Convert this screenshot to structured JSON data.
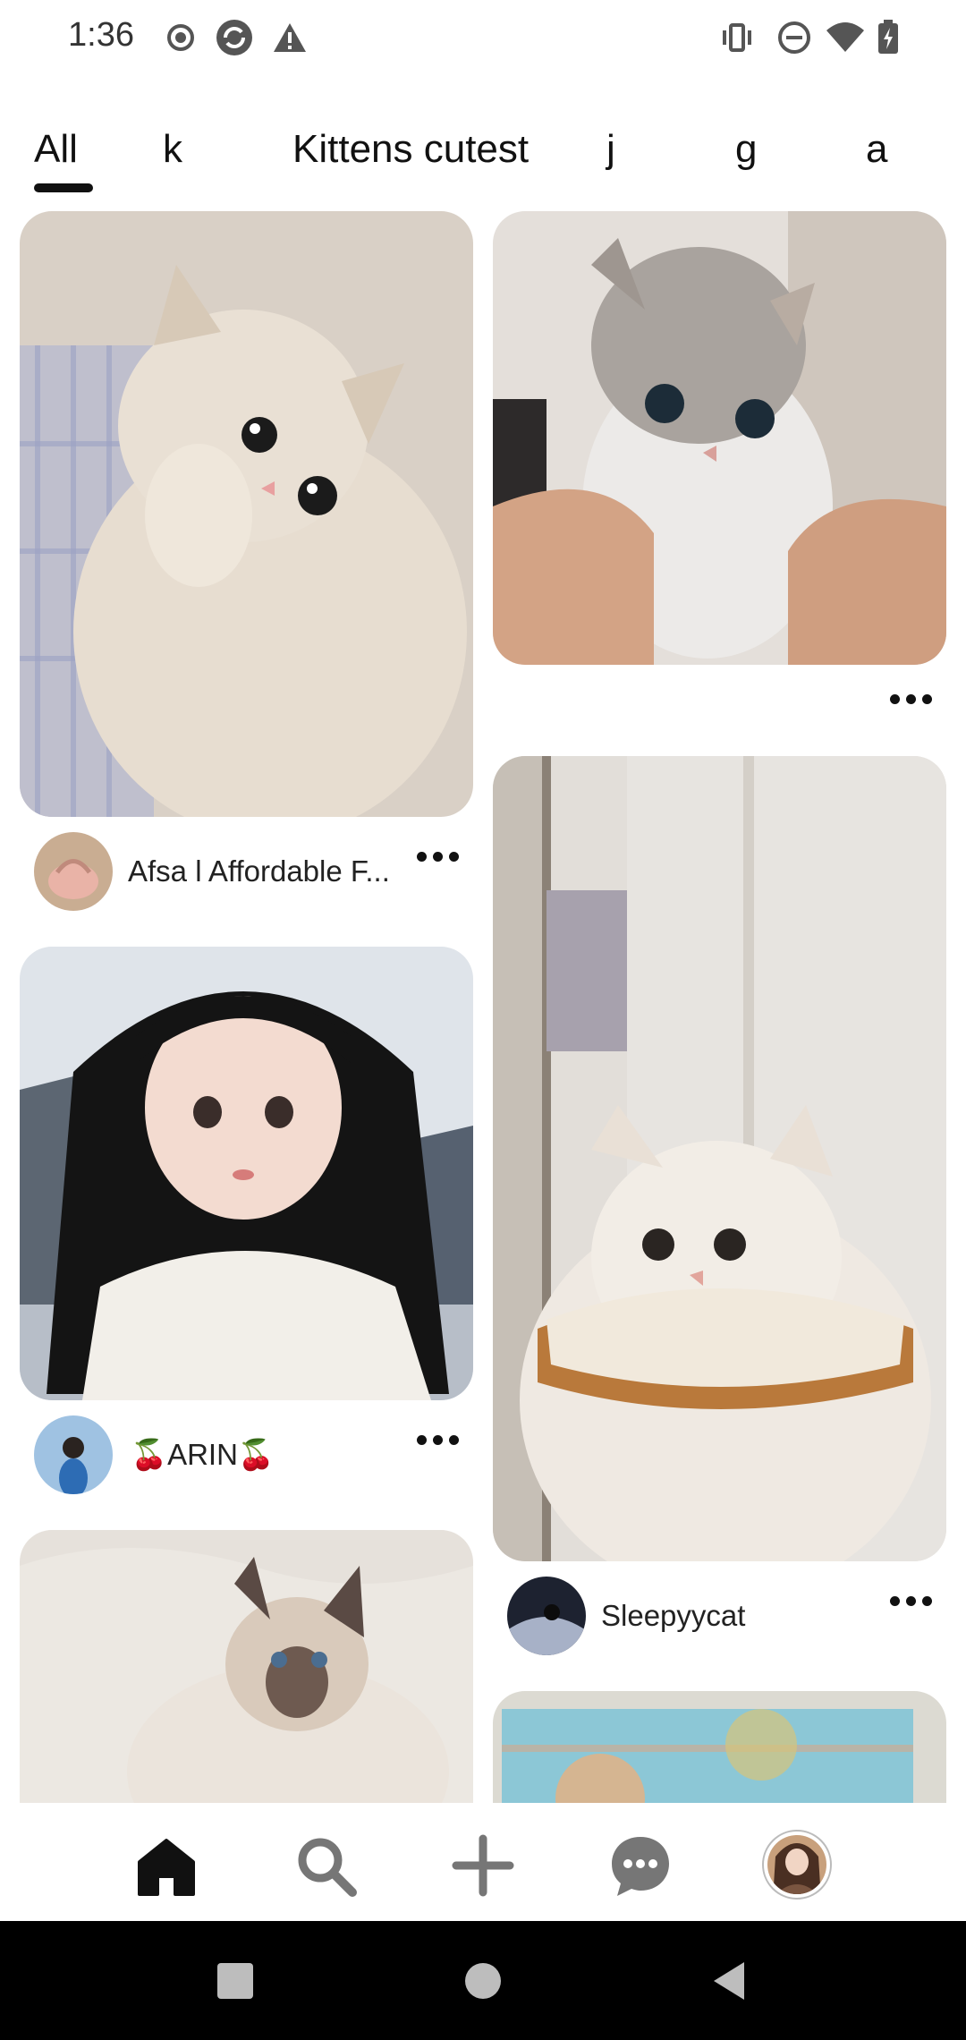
{
  "status_bar": {
    "time": "1:36",
    "left_icons": [
      "record-icon",
      "sync-icon",
      "warning-icon"
    ],
    "right_icons": [
      "vibrate-icon",
      "do-not-disturb-icon",
      "wifi-icon",
      "battery-charging-icon"
    ]
  },
  "tabs": [
    {
      "label": "All",
      "selected": true
    },
    {
      "label": "k",
      "selected": false
    },
    {
      "label": "Kittens cutest",
      "selected": false
    },
    {
      "label": "j",
      "selected": false
    },
    {
      "label": "g",
      "selected": false
    },
    {
      "label": "a",
      "selected": false
    }
  ],
  "pins": [
    {
      "description": "Fluffy cream kitten lying on plaid blanket",
      "author": "Afsa l Affordable F..."
    },
    {
      "description": "Grey tabby kitten held in hands",
      "author": ""
    },
    {
      "description": "Anime girl with long black hair",
      "author": "🍒ARIN🍒"
    },
    {
      "description": "White fluffy cat wearing bread pillow",
      "author": "Sleepyycat"
    },
    {
      "description": "Siamese kitten on white bedding",
      "author": ""
    },
    {
      "description": "Window with colorful view",
      "author": ""
    }
  ],
  "bottom_nav": [
    "home-icon",
    "search-icon",
    "create-icon",
    "messages-icon",
    "profile-avatar"
  ],
  "system_nav": [
    "recents-icon",
    "home-circle-icon",
    "back-icon"
  ],
  "colors": {
    "text": "#111111",
    "background": "#ffffff",
    "system_nav": "#000000"
  }
}
